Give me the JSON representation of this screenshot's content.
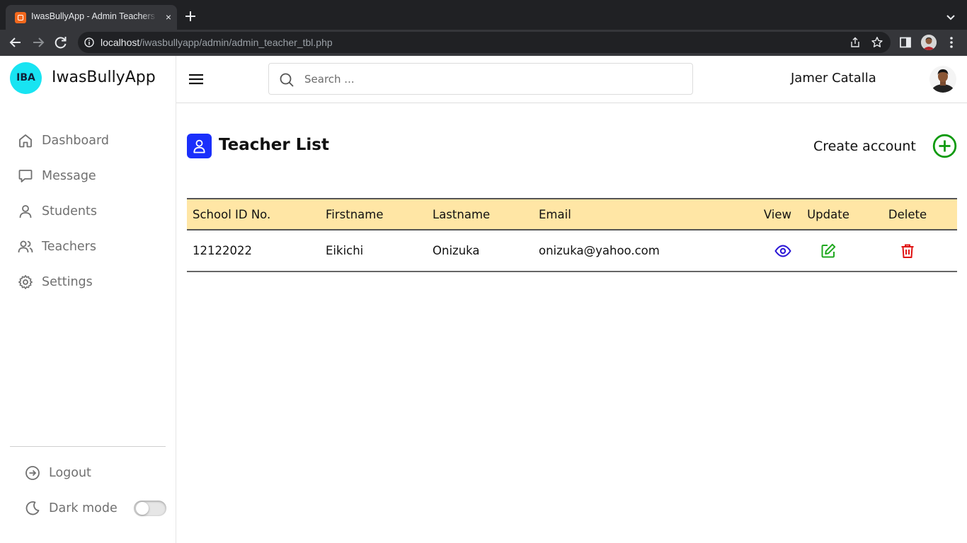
{
  "browser": {
    "tab_title": "IwasBullyApp - Admin Teachers",
    "tab_close": "×",
    "url_host": "localhost",
    "url_path": "/iwasbullyapp/admin/admin_teacher_tbl.php"
  },
  "sidebar": {
    "logo_text": "IBA",
    "brand": "IwasBullyApp",
    "items": [
      {
        "label": "Dashboard",
        "icon": "home-icon"
      },
      {
        "label": "Message",
        "icon": "message-icon"
      },
      {
        "label": "Students",
        "icon": "user-icon"
      },
      {
        "label": "Teachers",
        "icon": "users-icon"
      },
      {
        "label": "Settings",
        "icon": "gear-icon"
      }
    ],
    "logout_label": "Logout",
    "dark_mode_label": "Dark mode",
    "dark_mode_on": false
  },
  "header": {
    "search_placeholder": "Search ...",
    "user_name": "Jamer Catalla"
  },
  "main": {
    "title": "Teacher List",
    "create_label": "Create account",
    "table": {
      "columns": [
        "School ID No.",
        "Firstname",
        "Lastname",
        "Email",
        "View",
        "Update",
        "Delete"
      ],
      "rows": [
        {
          "school_id": "12122022",
          "firstname": "Eikichi",
          "lastname": "Onizuka",
          "email": "onizuka@yahoo.com"
        }
      ]
    }
  },
  "colors": {
    "accent_blue": "#1a2ffb",
    "logo_cyan": "#18e4f2",
    "table_header_bg": "#ffe6a5",
    "view_icon": "#2a16d6",
    "update_icon": "#1fa81f",
    "delete_icon": "#e01414",
    "create_icon": "#0e9a0e"
  }
}
